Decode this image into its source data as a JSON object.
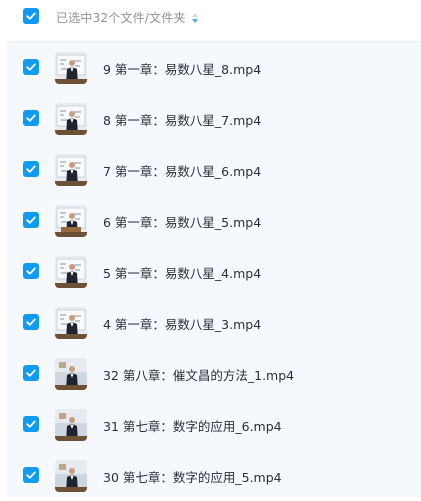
{
  "header": {
    "select_all_checked": true,
    "selection_summary": "已选中32个文件/文件夹",
    "sort_icon": "sort-arrows-icon"
  },
  "colors": {
    "checkbox": "#0e9bf1",
    "list_background": "#f5f9fe",
    "text": "#2b2f36",
    "summary_text": "#8c919e"
  },
  "files": [
    {
      "name": "9 第一章：易数八星_8.mp4",
      "checked": true,
      "thumb": "lecture-board"
    },
    {
      "name": "8 第一章：易数八星_7.mp4",
      "checked": true,
      "thumb": "lecture-board"
    },
    {
      "name": "7 第一章：易数八星_6.mp4",
      "checked": true,
      "thumb": "lecture-board"
    },
    {
      "name": "6 第一章：易数八星_5.mp4",
      "checked": true,
      "thumb": "lecture-podium"
    },
    {
      "name": "5 第一章：易数八星_4.mp4",
      "checked": true,
      "thumb": "lecture-board"
    },
    {
      "name": "4 第一章：易数八星_3.mp4",
      "checked": true,
      "thumb": "lecture-board"
    },
    {
      "name": "32 第八章：催文昌的方法_1.mp4",
      "checked": true,
      "thumb": "lecture-room"
    },
    {
      "name": "31 第七章：数字的应用_6.mp4",
      "checked": true,
      "thumb": "lecture-room"
    },
    {
      "name": "30 第七章：数字的应用_5.mp4",
      "checked": true,
      "thumb": "lecture-room"
    }
  ]
}
